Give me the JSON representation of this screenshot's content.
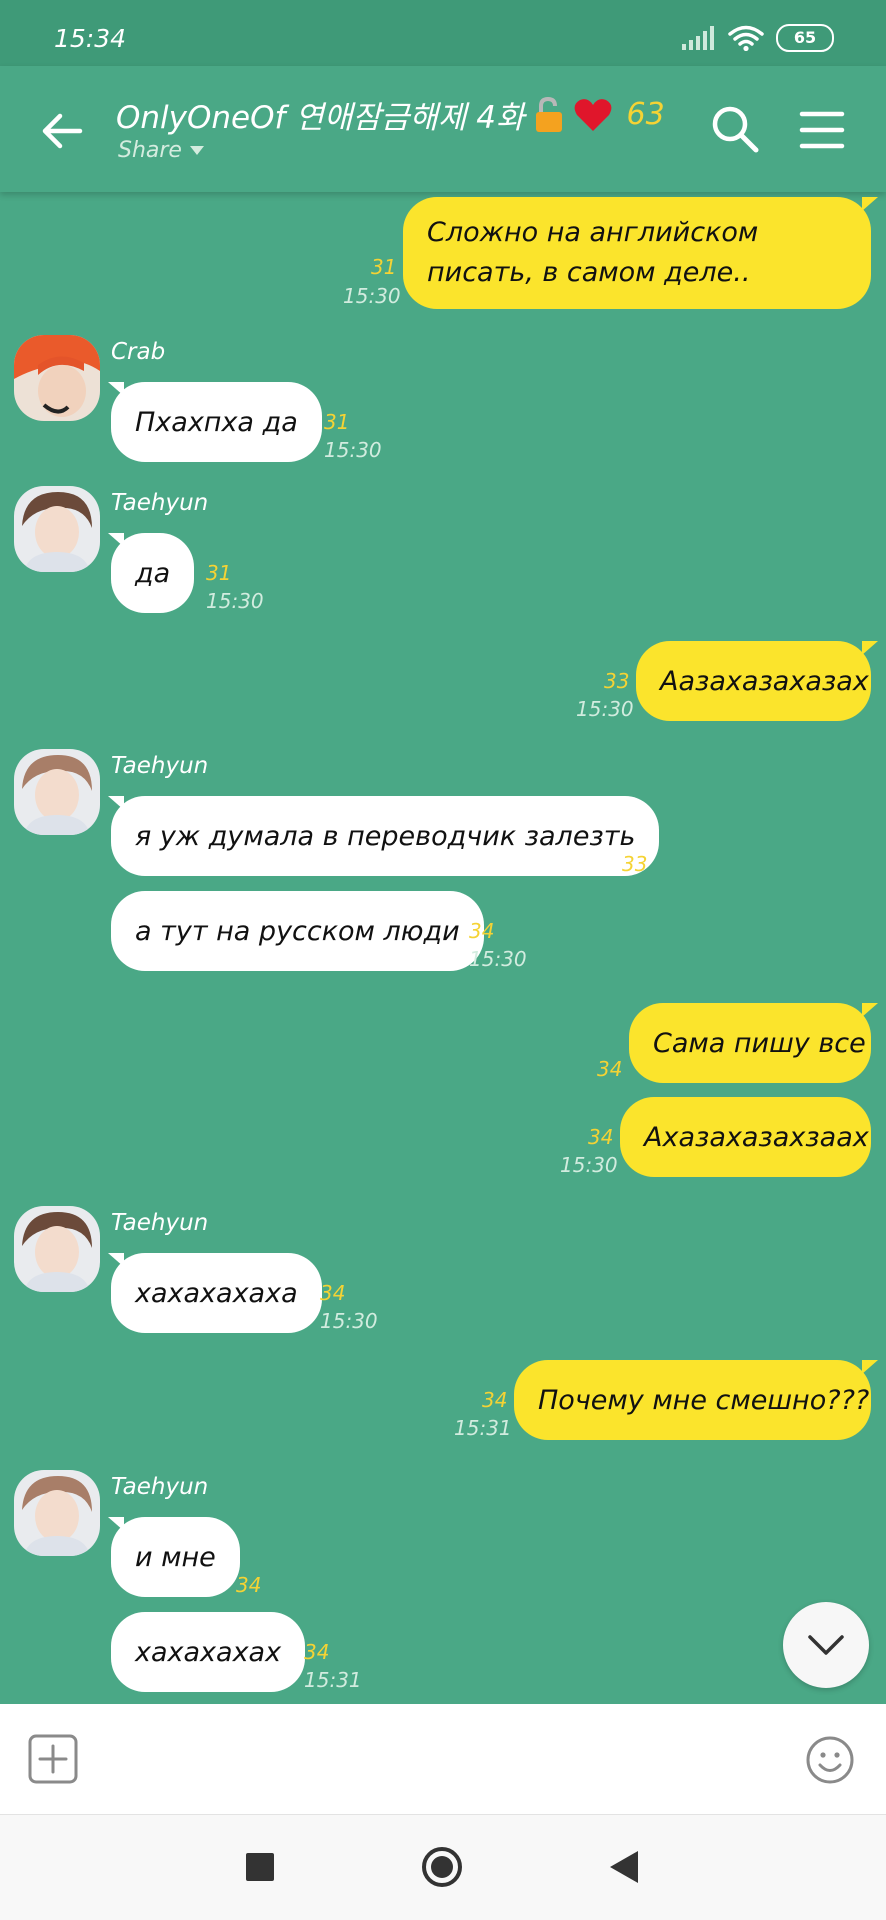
{
  "status_bar": {
    "time": "15:34",
    "battery": "65",
    "icons": [
      "signal-icon",
      "wifi-icon",
      "battery-icon"
    ]
  },
  "header": {
    "title": "OnlyOneOf 연애잠금해제 4화",
    "title_emojis": [
      "open-lock-icon",
      "red-heart-icon"
    ],
    "member_count": "63",
    "share_label": "Share",
    "icons": [
      "back-arrow-icon",
      "search-icon",
      "menu-icon"
    ]
  },
  "messages": [
    {
      "id": 1,
      "from": "me",
      "text": "Сложно на английском писать, в самом деле..",
      "read": "31",
      "time": "15:30"
    },
    {
      "id": 2,
      "from": "Crab",
      "text": "Пхахпха да",
      "read": "31",
      "time": "15:30"
    },
    {
      "id": 3,
      "from": "Taehyun",
      "text": "да",
      "read": "31",
      "time": "15:30"
    },
    {
      "id": 4,
      "from": "me",
      "text": "Аазахазахазах",
      "read": "33",
      "time": "15:30"
    },
    {
      "id": 5,
      "from": "Taehyun",
      "text": "я уж думала в переводчик залезть",
      "read": "33",
      "time": ""
    },
    {
      "id": 6,
      "from": "Taehyun",
      "text": "а тут на русском люди",
      "read": "34",
      "time": "15:30"
    },
    {
      "id": 7,
      "from": "me",
      "text": "Сама пишу все",
      "read": "34",
      "time": ""
    },
    {
      "id": 8,
      "from": "me",
      "text": "Ахазахазахзаах",
      "read": "34",
      "time": "15:30"
    },
    {
      "id": 9,
      "from": "Taehyun",
      "text": "хахахахаха",
      "read": "34",
      "time": "15:30"
    },
    {
      "id": 10,
      "from": "me",
      "text": "Почему мне смешно???",
      "read": "34",
      "time": "15:31"
    },
    {
      "id": 11,
      "from": "Taehyun",
      "text": "и мне",
      "read": "34",
      "time": ""
    },
    {
      "id": 12,
      "from": "Taehyun",
      "text": "хахахахах",
      "read": "34",
      "time": "15:31"
    }
  ],
  "colors": {
    "background": "#4aa886",
    "my_bubble": "#fbe42c",
    "their_bubble": "#ffffff",
    "read_count": "#f5d334"
  }
}
